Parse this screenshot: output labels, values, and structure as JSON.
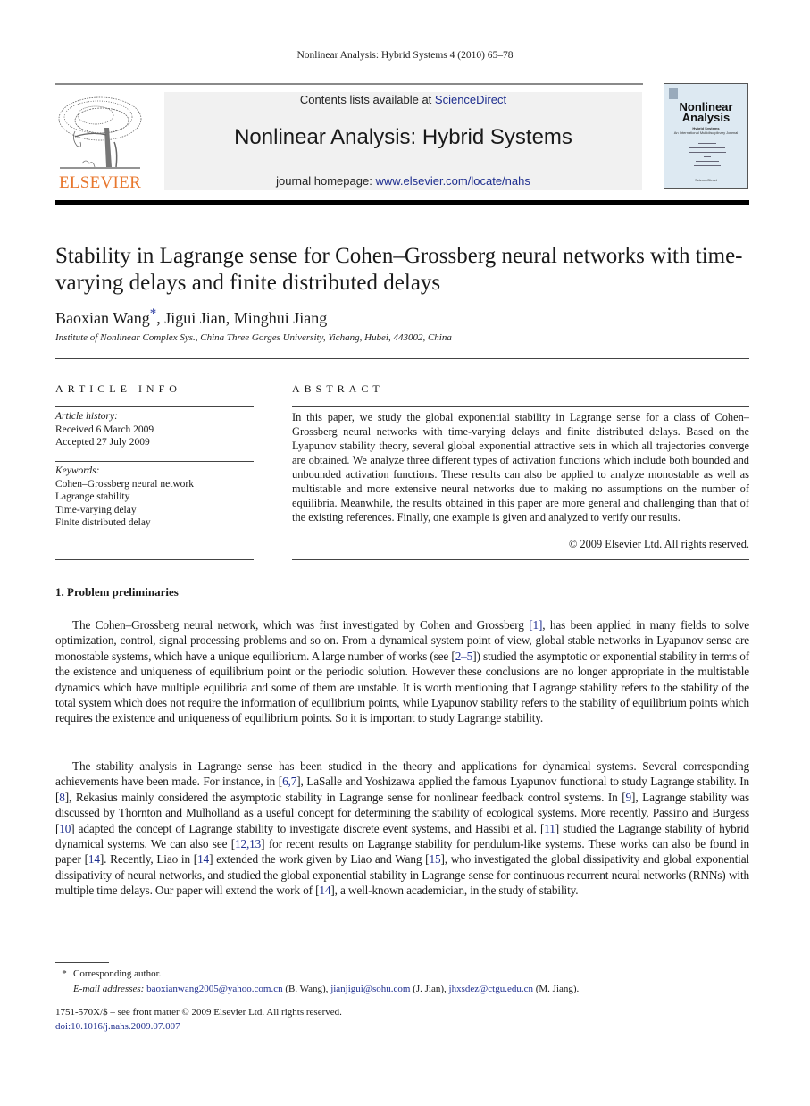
{
  "running_head": "Nonlinear Analysis: Hybrid Systems 4 (2010) 65–78",
  "header": {
    "publisher_logo": "elsevier-tree-logo",
    "publisher_name": "ELSEVIER",
    "contents_prefix": "Contents lists available at ",
    "contents_link": "ScienceDirect",
    "journal_name": "Nonlinear Analysis: Hybrid Systems",
    "homepage_prefix": "journal homepage: ",
    "homepage_link": "www.elsevier.com/locate/nahs",
    "cover": {
      "title_line1": "Nonlinear",
      "title_line2": "Analysis",
      "subtitle": "Hybrid Systems",
      "subtitle2": "An International Multidisciplinary Journal",
      "footer": "ScienceDirect"
    }
  },
  "article": {
    "title": "Stability in Lagrange sense for Cohen–Grossberg neural networks with time-varying delays and finite distributed delays",
    "authors": [
      {
        "name": "Baoxian Wang",
        "mark": "*"
      },
      {
        "name": "Jigui Jian"
      },
      {
        "name": "Minghui Jiang"
      }
    ],
    "affiliation": "Institute of Nonlinear Complex Sys., China Three Gorges University, Yichang, Hubei, 443002, China"
  },
  "article_info": {
    "heading": "ARTICLE INFO",
    "history_label": "Article history:",
    "received": "Received 6 March 2009",
    "accepted": "Accepted 27 July 2009",
    "keywords_label": "Keywords:",
    "keywords": [
      "Cohen–Grossberg neural network",
      "Lagrange stability",
      "Time-varying delay",
      "Finite distributed delay"
    ]
  },
  "abstract": {
    "heading": "ABSTRACT",
    "text": "In this paper, we study the global exponential stability in Lagrange sense for a class of Cohen–Grossberg neural networks with time-varying delays and finite distributed delays. Based on the Lyapunov stability theory, several global exponential attractive sets in which all trajectories converge are obtained. We analyze three different types of activation functions which include both bounded and unbounded activation functions. These results can also be applied to analyze monostable as well as multistable and more extensive neural networks due to making no assumptions on the number of equilibria. Meanwhile, the results obtained in this paper are more general and challenging than that of the existing references. Finally, one example is given and analyzed to verify our results.",
    "copyright": "© 2009 Elsevier Ltd. All rights reserved."
  },
  "section1": {
    "heading": "1.  Problem preliminaries",
    "par1": [
      {
        "t": "The Cohen–Grossberg neural network, which was first investigated by Cohen and Grossberg "
      },
      {
        "ref": "[1]"
      },
      {
        "t": ", has been applied in many fields to solve optimization, control, signal processing problems and so on. From a dynamical system point of view, global stable networks in Lyapunov sense are monostable systems, which have a unique equilibrium. A large number of works (see ["
      },
      {
        "ref": "2–5"
      },
      {
        "t": "]) studied the asymptotic or exponential stability in terms of the existence and uniqueness of equilibrium point or the periodic solution. However these conclusions are no longer appropriate in the multistable dynamics which have multiple equilibria and some of them are unstable. It is worth mentioning that Lagrange stability refers to the stability of the total system which does not require the information of equilibrium points, while Lyapunov stability refers to the stability of equilibrium points which requires the existence and uniqueness of equilibrium points. So it is important to study Lagrange stability."
      }
    ],
    "par2": [
      {
        "t": "The stability analysis in Lagrange sense has been studied in the theory and applications for dynamical systems. Several corresponding achievements have been made. For instance, in ["
      },
      {
        "ref": "6,7"
      },
      {
        "t": "], LaSalle and Yoshizawa applied the famous Lyapunov functional to study Lagrange stability. In ["
      },
      {
        "ref": "8"
      },
      {
        "t": "], Rekasius mainly considered the asymptotic stability in Lagrange sense for nonlinear feedback control systems. In ["
      },
      {
        "ref": "9"
      },
      {
        "t": "], Lagrange stability was discussed by Thornton and Mulholland as a useful concept for determining the stability of ecological systems. More recently, Passino and Burgess ["
      },
      {
        "ref": "10"
      },
      {
        "t": "] adapted the concept of Lagrange stability to investigate discrete event systems, and Hassibi et al. ["
      },
      {
        "ref": "11"
      },
      {
        "t": "] studied the Lagrange stability of hybrid dynamical systems. We can also see ["
      },
      {
        "ref": "12,13"
      },
      {
        "t": "] for recent results on Lagrange stability for pendulum-like systems. These works can also be found in paper ["
      },
      {
        "ref": "14"
      },
      {
        "t": "]. Recently, Liao in ["
      },
      {
        "ref": "14"
      },
      {
        "t": "] extended the work given by Liao and Wang ["
      },
      {
        "ref": "15"
      },
      {
        "t": "], who investigated the global dissipativity and global exponential dissipativity of neural networks, and studied the global exponential stability in Lagrange sense for continuous recurrent neural networks (RNNs) with multiple time delays. Our paper will extend the work of ["
      },
      {
        "ref": "14"
      },
      {
        "t": "], a well-known academician, in the study of stability."
      }
    ]
  },
  "footnotes": {
    "star": "*",
    "corresponding": "Corresponding author.",
    "email_label": "E-mail addresses:",
    "emails": [
      {
        "address": "baoxianwang2005@yahoo.com.cn",
        "who": " (B. Wang), "
      },
      {
        "address": "jianjigui@sohu.com",
        "who": " (J. Jian), "
      },
      {
        "address": "jhxsdez@ctgu.edu.cn",
        "who": " (M. Jiang)."
      }
    ],
    "issn": "1751-570X/$ – see front matter © 2009 Elsevier Ltd. All rights reserved.",
    "doi": "doi:10.1016/j.nahs.2009.07.007"
  },
  "colors": {
    "link": "#1f2f8f",
    "elsevier_orange": "#e8772e",
    "banner_bg": "#f1f1f1"
  }
}
